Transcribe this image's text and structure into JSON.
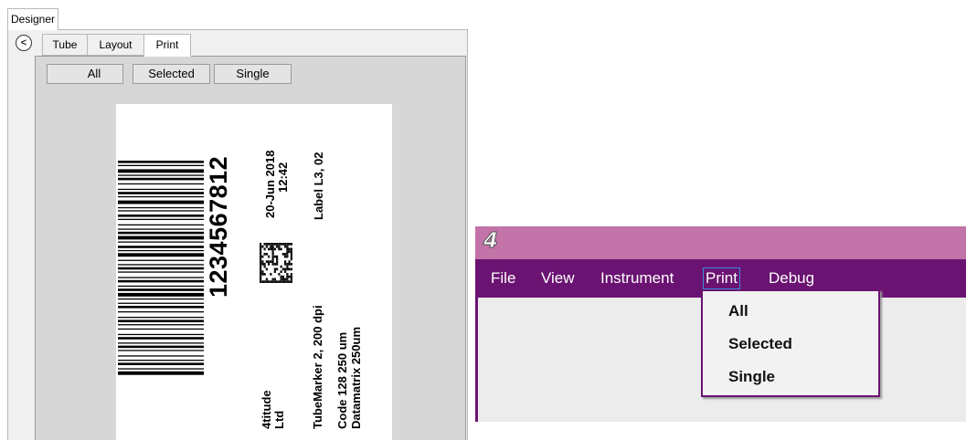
{
  "designer": {
    "tab_label": "Designer",
    "back_glyph": "<",
    "subtabs": [
      {
        "label": "Tube"
      },
      {
        "label": "Layout"
      },
      {
        "label": "Print"
      }
    ],
    "print_buttons": {
      "all": "All",
      "selected": "Selected",
      "single": "Single"
    },
    "label": {
      "barcode_number": "1234567812",
      "date": "20-Jun 2018",
      "time": "12:42",
      "label_code": "Label L3, 02",
      "company_line1": "4titude",
      "company_line2": "Ltd",
      "printer": "TubeMarker 2, 200 dpi",
      "code128": "Code 128 250 um",
      "datamatrix": "Datamatrix 250um"
    }
  },
  "app": {
    "logo_glyph": "4",
    "colors": {
      "titlebar": "#c273a8",
      "menubar": "#6b1372"
    },
    "menu": [
      {
        "label": "File"
      },
      {
        "label": "View"
      },
      {
        "label": "Instrument"
      },
      {
        "label": "Print"
      },
      {
        "label": "Debug"
      }
    ],
    "print_menu": [
      {
        "label": "All"
      },
      {
        "label": "Selected"
      },
      {
        "label": "Single"
      }
    ]
  }
}
